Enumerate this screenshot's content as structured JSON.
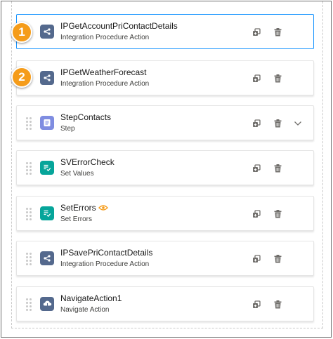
{
  "badges": [
    "1",
    "2"
  ],
  "cards": [
    {
      "title": "IPGetAccountPriContactDetails",
      "subtitle": "Integration Procedure Action",
      "icon": "integration-procedure-icon",
      "color": "#54698d"
    },
    {
      "title": "IPGetWeatherForecast",
      "subtitle": "Integration Procedure Action",
      "icon": "integration-procedure-icon",
      "color": "#54698d"
    },
    {
      "title": "StepContacts",
      "subtitle": "Step",
      "icon": "step-icon",
      "color": "#7f8de1"
    },
    {
      "title": "SVErrorCheck",
      "subtitle": "Set Values",
      "icon": "set-values-icon",
      "color": "#06a59a"
    },
    {
      "title": "SetErrors",
      "subtitle": "Set Errors",
      "icon": "set-values-icon",
      "color": "#06a59a"
    },
    {
      "title": "IPSavePriContactDetails",
      "subtitle": "Integration Procedure Action",
      "icon": "integration-procedure-icon",
      "color": "#54698d"
    },
    {
      "title": "NavigateAction1",
      "subtitle": "Navigate Action",
      "icon": "navigate-icon",
      "color": "#54698d"
    }
  ],
  "colors": {
    "selected_border": "#1b96ff",
    "badge": "#f59c1a",
    "action_icon": "#706e6b",
    "eye_icon": "#f59c1a"
  }
}
